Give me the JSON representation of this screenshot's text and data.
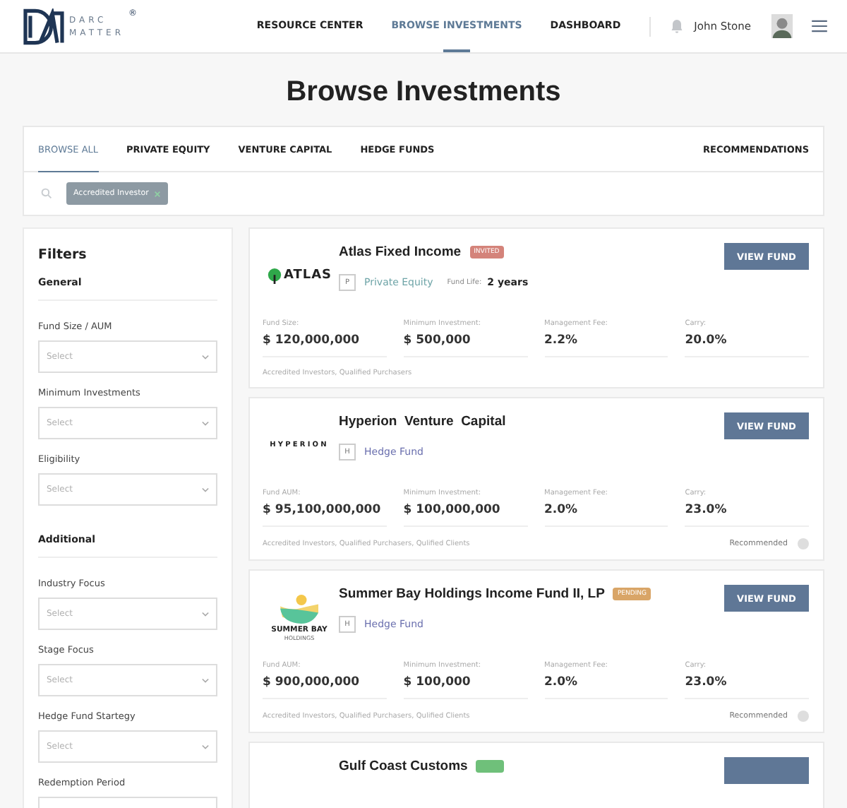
{
  "header": {
    "brand": [
      "DARC",
      "MATTER"
    ],
    "brand_mark": "®",
    "nav": [
      {
        "label": "RESOURCE CENTER",
        "selected": false
      },
      {
        "label": "BROWSE INVESTMENTS",
        "selected": true
      },
      {
        "label": "DASHBOARD",
        "selected": false
      }
    ],
    "user": "John Stone"
  },
  "title": "Browse Investments",
  "tabs": [
    {
      "label": "BROWSE ALL",
      "selected": true
    },
    {
      "label": "PRIVATE EQUITY",
      "selected": false
    },
    {
      "label": "VENTURE CAPITAL",
      "selected": false
    },
    {
      "label": "HEDGE FUNDS",
      "selected": false
    }
  ],
  "recommendations": "RECOMMENDATIONS",
  "search": {
    "chips": [
      "Accredited Investor"
    ]
  },
  "filters": {
    "title": "Filters",
    "sections": [
      {
        "heading": "General",
        "fields": [
          {
            "label": "Fund Size / AUM",
            "placeholder": "Select"
          },
          {
            "label": "Minimum Investments",
            "placeholder": "Select"
          },
          {
            "label": "Eligibility",
            "placeholder": "Select"
          }
        ]
      },
      {
        "heading": "Additional",
        "fields": [
          {
            "label": "Industry Focus",
            "placeholder": "Select"
          },
          {
            "label": "Stage Focus",
            "placeholder": "Select"
          },
          {
            "label": "Hedge Fund Startegy",
            "placeholder": "Select"
          },
          {
            "label": "Redemption Period"
          }
        ]
      }
    ]
  },
  "funds": [
    {
      "logo": {
        "kind": "atlas",
        "text": [
          "ATLAS"
        ]
      },
      "name": "Atlas Fixed Income",
      "badge": {
        "label": "INVITED",
        "color": "#d4837a"
      },
      "type_letter": "P",
      "type": {
        "label": "Private Equity",
        "color": "#6fa5a8"
      },
      "fund_life_label": "Fund Life:",
      "fund_life": "2 years",
      "button": "VIEW FUND",
      "stats": [
        {
          "label": "Fund Size:",
          "value": "$ 120,000,000"
        },
        {
          "label": "Minimum Investment:",
          "value": "$ 500,000"
        },
        {
          "label": "Management Fee:",
          "value": "2.2%"
        },
        {
          "label": "Carry:",
          "value": "20.0%"
        }
      ],
      "eligibility": "Accredited Investors, Qualified Purchasers"
    },
    {
      "logo": {
        "kind": "hyperion",
        "text": [
          "HYPERION"
        ]
      },
      "name": "Hyperion  Venture  Capital",
      "type_letter": "H",
      "type": {
        "label": "Hedge Fund",
        "color": "#6a6fae"
      },
      "button": "VIEW FUND",
      "stats": [
        {
          "label": "Fund AUM:",
          "value": "$ 95,100,000,000"
        },
        {
          "label": "Minimum Investment:",
          "value": "$ 100,000,000"
        },
        {
          "label": "Management Fee:",
          "value": "2.0%"
        },
        {
          "label": "Carry:",
          "value": "23.0%"
        }
      ],
      "eligibility": "Accredited Investors, Qualified Purchasers, Qulified Clients",
      "recommended": "Recommended"
    },
    {
      "logo": {
        "kind": "summer",
        "text": [
          "SUMMER BAY",
          "HOLDINGS"
        ]
      },
      "name": "Summer Bay Holdings Income Fund II, LP",
      "badge": {
        "label": "PENDING",
        "color": "#d9a567"
      },
      "type_letter": "H",
      "type": {
        "label": "Hedge Fund",
        "color": "#6a6fae"
      },
      "button": "VIEW FUND",
      "stats": [
        {
          "label": "Fund AUM:",
          "value": "$ 900,000,000"
        },
        {
          "label": "Minimum Investment:",
          "value": "$ 100,000"
        },
        {
          "label": "Management Fee:",
          "value": "2.0%"
        },
        {
          "label": "Carry:",
          "value": "23.0%"
        }
      ],
      "eligibility": "Accredited Investors, Qualified Purchasers, Qulified Clients",
      "recommended": "Recommended"
    },
    {
      "name": "Gulf Coast Customs",
      "badge": {
        "color": "#6fc07a"
      }
    }
  ]
}
